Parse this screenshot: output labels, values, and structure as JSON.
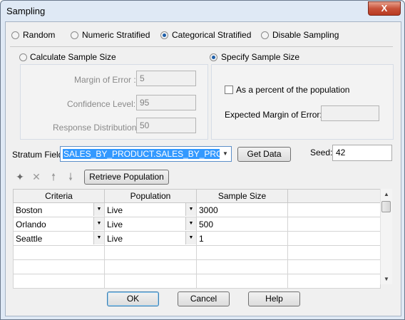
{
  "window": {
    "title": "Sampling",
    "close_label": "X"
  },
  "sampling_modes": [
    "Random",
    "Numeric Stratified",
    "Categorical Stratified",
    "Disable Sampling"
  ],
  "selected_mode": "Categorical Stratified",
  "calc": {
    "label": "Calculate Sample Size",
    "margin_label": "Margin of Error :",
    "margin_value": "5",
    "confidence_label": "Confidence Level:",
    "confidence_value": "95",
    "response_label": "Response Distribution:",
    "response_value": "50"
  },
  "specify": {
    "label": "Specify Sample Size",
    "percent_label": "As a percent of the population",
    "expected_label": "Expected Margin of Error:",
    "expected_value": ""
  },
  "stratum": {
    "label": "Stratum Field:",
    "value": "SALES_BY_PRODUCT.SALES_BY_PRODUCT",
    "get_data": "Get Data",
    "seed_label": "Seed:",
    "seed_value": "42"
  },
  "toolbar": {
    "retrieve": "Retrieve Population"
  },
  "table": {
    "columns": [
      "Criteria",
      "Population",
      "Sample Size"
    ],
    "rows": [
      {
        "criteria": "Boston",
        "population": "Live",
        "sample_size": "3000"
      },
      {
        "criteria": "Orlando",
        "population": "Live",
        "sample_size": "500"
      },
      {
        "criteria": "Seattle",
        "population": "Live",
        "sample_size": "1"
      }
    ]
  },
  "buttons": {
    "ok": "OK",
    "cancel": "Cancel",
    "help": "Help"
  }
}
